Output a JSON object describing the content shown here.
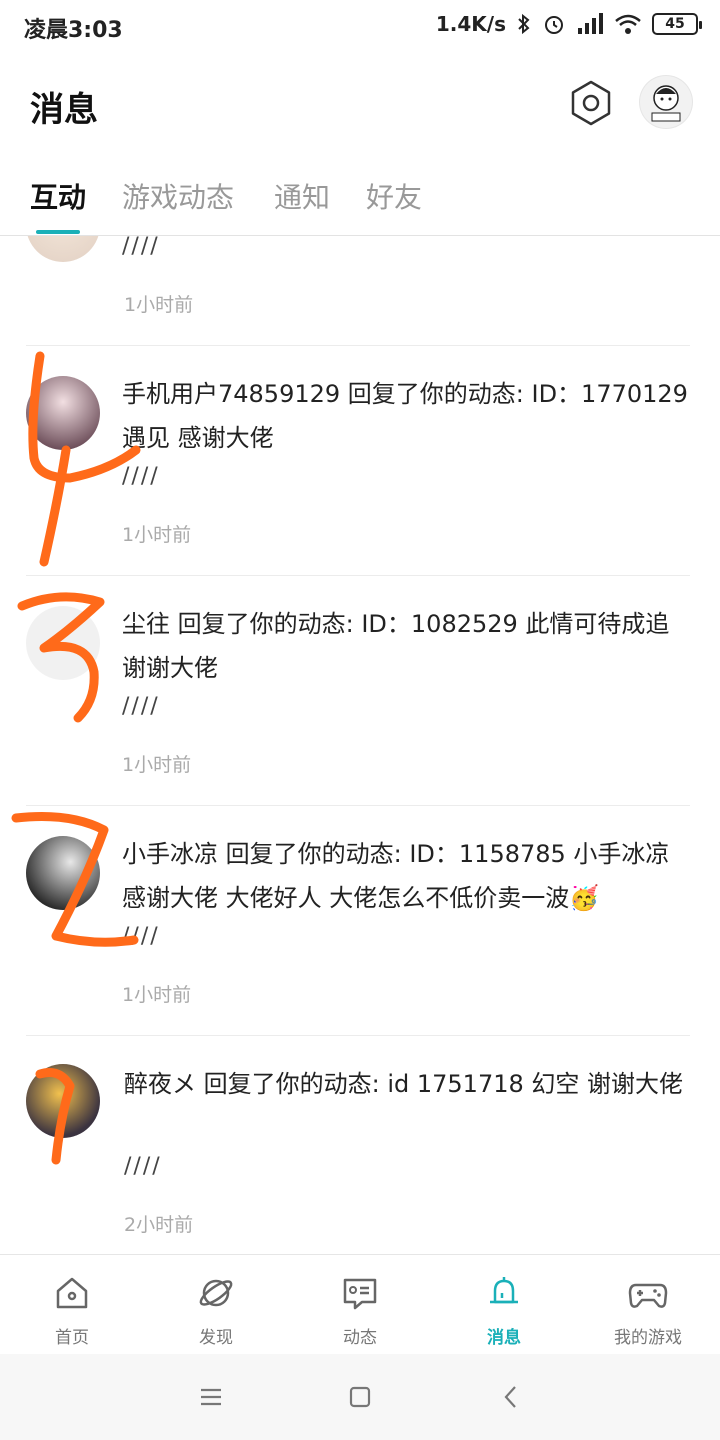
{
  "status_bar": {
    "time": "凌晨3:03",
    "net_speed": "1.4K/s",
    "battery": "45"
  },
  "header": {
    "title": "消息"
  },
  "tabs": [
    {
      "label": "互动",
      "active": true
    },
    {
      "label": "游戏动态",
      "active": false
    },
    {
      "label": "通知",
      "active": false
    },
    {
      "label": "好友",
      "active": false
    }
  ],
  "messages": [
    {
      "text": "",
      "slashes": "////",
      "time": "1小时前"
    },
    {
      "text": "手机用户74859129 回复了你的动态: ID：1770129 遇见 感谢大佬",
      "slashes": "////",
      "time": "1小时前"
    },
    {
      "text": "尘往 回复了你的动态: ID：1082529 此情可待成追 谢谢大佬",
      "slashes": "////",
      "time": "1小时前"
    },
    {
      "text": "小手冰凉 回复了你的动态: ID：1158785 小手冰凉 感谢大佬 大佬好人 大佬怎么不低价卖一波🥳",
      "slashes": "////",
      "time": "1小时前"
    },
    {
      "text": "醉夜メ 回复了你的动态: id   1751718  幻空 谢谢大佬",
      "slashes": "////",
      "time": "2小时前"
    }
  ],
  "bottom_nav": [
    {
      "label": "首页",
      "icon": "home-icon",
      "active": false
    },
    {
      "label": "发现",
      "icon": "planet-icon",
      "active": false
    },
    {
      "label": "动态",
      "icon": "feed-icon",
      "active": false
    },
    {
      "label": "消息",
      "icon": "bell-icon",
      "active": true
    },
    {
      "label": "我的游戏",
      "icon": "gamepad-icon",
      "active": false
    }
  ],
  "colors": {
    "accent": "#1ab0b8",
    "annotation": "#ff6a1a"
  }
}
